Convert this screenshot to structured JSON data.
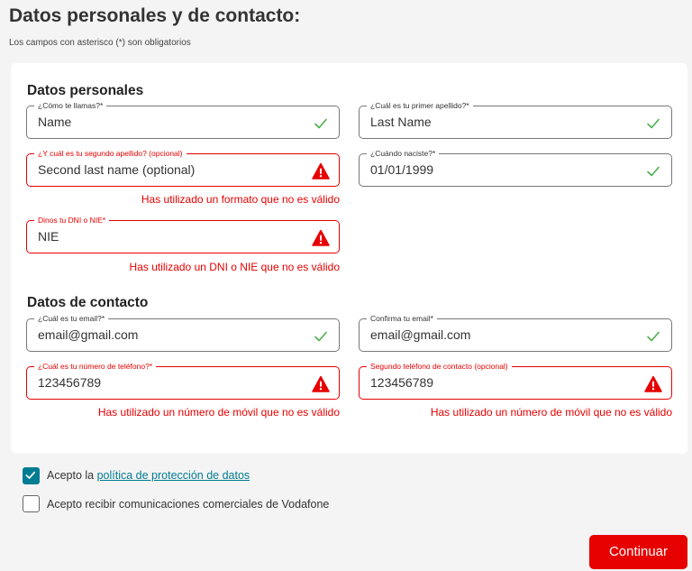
{
  "page": {
    "title": "Datos personales y de contacto:",
    "required_note": "Los campos con asterisco (*) son obligatorios"
  },
  "personal": {
    "title": "Datos personales",
    "first_name": {
      "label": "¿Cómo te llamas?*",
      "value": "Name",
      "state": "valid",
      "icon": "check-icon"
    },
    "last_name": {
      "label": "¿Cuál es tu primer apellido?*",
      "value": "Last Name",
      "state": "valid",
      "icon": "check-icon"
    },
    "second_last_name": {
      "label": "¿Y cuál es tu segundo apellido? (opcional)",
      "value": "Second last name (optional)",
      "state": "error",
      "icon": "warning-icon",
      "error": "Has utilizado un formato que no es válido"
    },
    "birth_date": {
      "label": "¿Cuándo naciste?*",
      "value": "01/01/1999",
      "state": "valid",
      "icon": "check-icon"
    },
    "dni": {
      "label": "Dinos tu DNI o NIE*",
      "value": "NIE",
      "state": "error",
      "icon": "warning-icon",
      "error": "Has utilizado un DNI o NIE que no es válido"
    }
  },
  "contact": {
    "title": "Datos de contacto",
    "email": {
      "label": "¿Cuál es tu email?*",
      "value": "email@gmail.com",
      "state": "valid",
      "icon": "check-icon"
    },
    "email_confirm": {
      "label": "Confirma tu email*",
      "value": "email@gmail.com",
      "state": "valid",
      "icon": "check-icon"
    },
    "phone": {
      "label": "¿Cuál es tu número de teléfono?*",
      "value": "123456789",
      "state": "error",
      "icon": "warning-icon",
      "error": "Has utilizado un número de móvil que no es válido"
    },
    "phone2": {
      "label": "Segundo teléfono de contacto (opcional)",
      "value": "123456789",
      "state": "error",
      "icon": "warning-icon",
      "error": "Has utilizado un número de móvil que no es válido"
    }
  },
  "consents": {
    "privacy": {
      "prefix": "Acepto la ",
      "link": "política de protección de datos",
      "checked": true
    },
    "marketing": {
      "label": "Acepto recibir comunicaciones comerciales de Vodafone",
      "checked": false
    }
  },
  "actions": {
    "continue_label": "Continuar"
  },
  "colors": {
    "error": "#e60000",
    "valid": "#4caf50",
    "checkbox": "#007c92",
    "button": "#e60000"
  }
}
